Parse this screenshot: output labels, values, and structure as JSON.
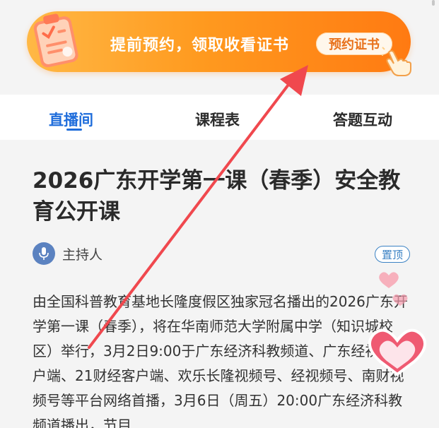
{
  "banner": {
    "text": "提前预约，领取收看证书",
    "button_label": "预约证书"
  },
  "tabs": [
    {
      "label": "直播间",
      "active": true
    },
    {
      "label": "课程表",
      "active": false
    },
    {
      "label": "答题互动",
      "active": false
    }
  ],
  "article": {
    "title": "2026广东开学第一课（春季）安全教育公开课",
    "host_label": "主持人",
    "pin_label": "置顶",
    "description": "由全国科普教育基地长隆度假区独家冠名播出的2026广东开学第一课（春季），将在华南师范大学附属中学（知识城校区）举行，3月2日9:00于广东经济科教频道、广东经视频客户端、21财经客户端、欢乐长隆视频号、经视频号、南财视频号等平台网络首播，3月6日（周五）20:00广东经济科教频道播出，节目"
  },
  "colors": {
    "accent_blue": "#1f6ddb",
    "banner_orange": "#ff8a1a",
    "annotation_red": "#f0484e"
  }
}
